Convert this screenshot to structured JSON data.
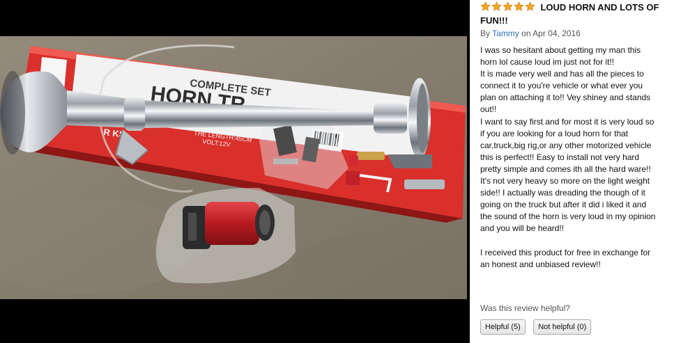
{
  "product_photo": {
    "box_header": "COMPLETE SET",
    "box_title": "HORN TR",
    "box_brand_partial": "R KS",
    "box_length": "THE LENGTH:45CM",
    "box_volt": "VOLT:12V",
    "colors": {
      "box_red": "#d9302c",
      "chrome": "#c9ccd1",
      "compressor_red": "#c81f26",
      "ground": "#8e8677"
    }
  },
  "review": {
    "rating": 5,
    "star_icon": "star-icon",
    "star_color": "#f5a623",
    "title": "LOUD HORN AND LOTS OF FUN!!!",
    "by_prefix": "By",
    "author": "Tammy",
    "date_text": "on Apr 04, 2016",
    "body_lines": [
      "I was so hesitant about getting my man this",
      "horn lol cause loud im just not for it!!",
      "It is made very well and has all the pieces to",
      "connect it to you're vehicle or what ever you",
      "plan on attaching it to!! Vey shiney and stands",
      "out!!",
      "I want to say first and for most it is very loud so",
      "if you are looking for a loud horn for that",
      "car,truck,big rig,or any other motorized vehicle",
      "this is perfect!! Easy to install not very hard",
      "pretty simple and comes ith all the hard ware!!",
      "It's not very heavy so more on the light weight",
      "side!! I actually was dreading the though of it",
      "going on the truck but after it did i liked it and",
      "the sound of the horn is very loud in my opinion",
      "and you will be heard!!",
      "",
      "I received this product for free in exchange for",
      "an honest and unbiased review!!"
    ],
    "helpful_question": "Was this review helpful?",
    "helpful_button": "Helpful (5)",
    "not_helpful_button": "Not helpful (0)"
  }
}
